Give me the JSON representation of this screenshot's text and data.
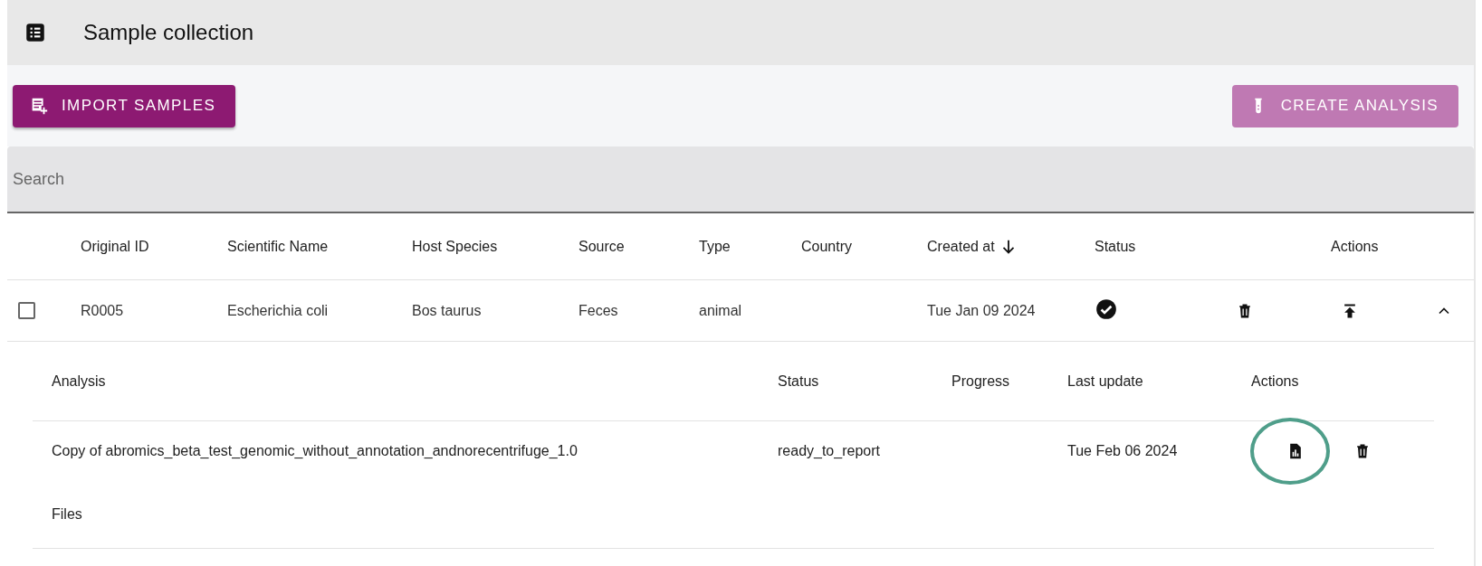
{
  "header": {
    "title": "Sample collection"
  },
  "toolbar": {
    "buttons": [
      {
        "label": "IMPORT SAMPLES",
        "kind": "import",
        "disabled": false
      },
      {
        "label": "CREATE ANALYSIS",
        "kind": "analysis",
        "disabled": true
      }
    ]
  },
  "search": {
    "placeholder": "Search"
  },
  "table": {
    "columns": [
      {
        "label": "Original ID",
        "sorted": false
      },
      {
        "label": "Scientific Name",
        "sorted": false
      },
      {
        "label": "Host Species",
        "sorted": false
      },
      {
        "label": "Source",
        "sorted": false
      },
      {
        "label": "Type",
        "sorted": false
      },
      {
        "label": "Country",
        "sorted": false
      },
      {
        "label": "Created at",
        "sorted": true
      },
      {
        "label": "Status",
        "sorted": false
      },
      {
        "label": "Actions",
        "sorted": false
      }
    ],
    "rows": [
      {
        "selected": false,
        "expanded": true,
        "original_id": "R0005",
        "scientific_name": "Escherichia coli",
        "host_species": "Bos taurus",
        "source": "Feces",
        "type": "animal",
        "created_at": "Tue Jan 09 2024",
        "complete": true,
        "analyses": {
          "columns": [
            "Analysis",
            "Status",
            "Progress",
            "Last update",
            "Actions"
          ],
          "rows": [
            {
              "name": "Copy of abromics_beta_test_genomic_without_annotation_andnorecentrifuge_1.0",
              "status": "ready_to_report",
              "last_update": "Tue Feb 06 2024",
              "report_highlighted": true
            }
          ],
          "files_label": "Files"
        }
      }
    ]
  }
}
